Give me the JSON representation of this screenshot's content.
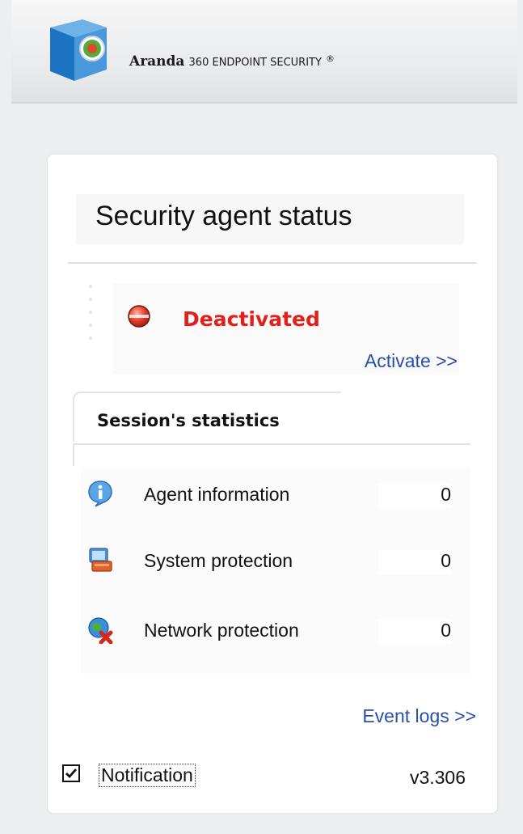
{
  "brand": {
    "name_bold": "Aranda",
    "name_rest": "360 ENDPOINT SECURITY",
    "mark": "®",
    "logo_icon": "aranda-cube-logo"
  },
  "panel": {
    "title": "Security agent status",
    "status": {
      "text": "Deactivated",
      "icon": "status-red-light-icon",
      "color": "#e0201a"
    },
    "activate_link": "Activate >>",
    "stats": {
      "title": "Session's statistics",
      "rows": [
        {
          "label": "Agent information",
          "value": "0",
          "icon": "info-icon"
        },
        {
          "label": "System protection",
          "value": "0",
          "icon": "system-protection-icon"
        },
        {
          "label": "Network protection",
          "value": "0",
          "icon": "network-protection-icon"
        }
      ]
    },
    "event_logs_link": "Event logs >>",
    "notification": {
      "label": "Notification",
      "checked": true
    },
    "version": "v3.306"
  },
  "colors": {
    "link": "#2a4fa8",
    "status_red": "#e0201a"
  }
}
